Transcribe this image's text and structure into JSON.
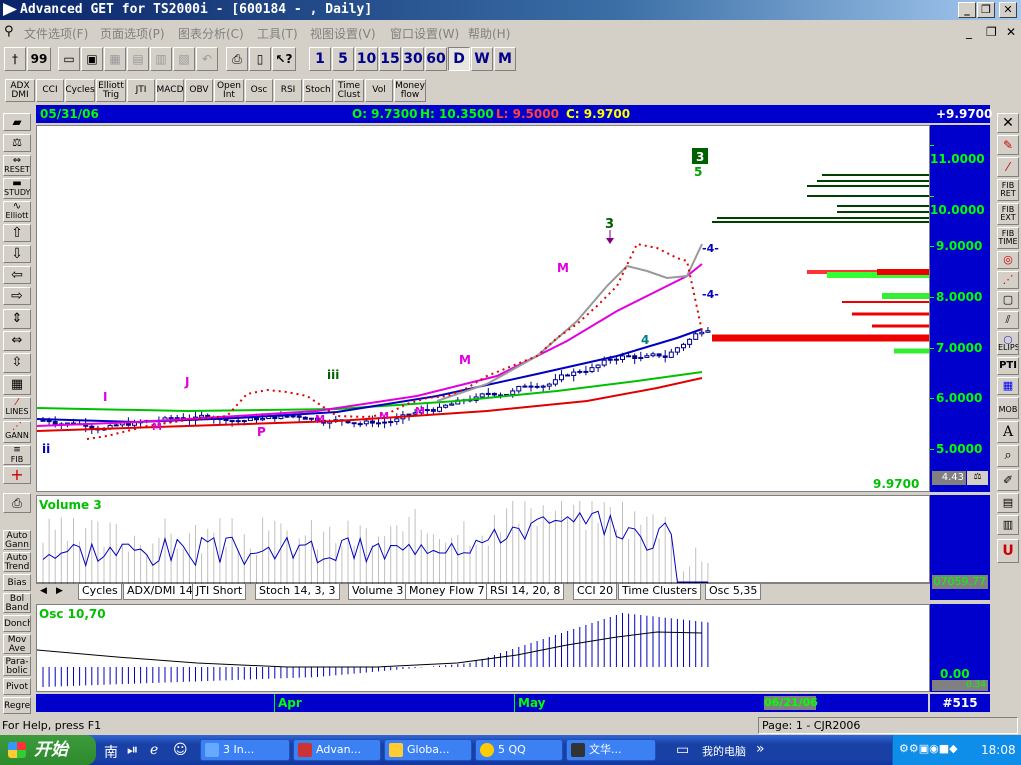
{
  "window": {
    "title": "Advanced GET for TS2000i - [600184 - , Daily]",
    "minimize": "_",
    "restore": "❐",
    "close": "✕"
  },
  "menu": {
    "items": [
      "文件选项(F)",
      "页面选项(P)",
      "图表分析(C)",
      "工具(T)",
      "视图设置(V)",
      "窗口设置(W)",
      "帮助(H)"
    ],
    "right_controls": [
      "_",
      "❐",
      "✕"
    ]
  },
  "toolbar": {
    "left_icons": [
      "†",
      "99"
    ],
    "periods": [
      "1",
      "5",
      "10",
      "15",
      "30",
      "60",
      "D",
      "W",
      "M"
    ],
    "active_period": "D"
  },
  "indicator_bar": {
    "buttons": [
      [
        "ADX",
        "DMI"
      ],
      [
        "CCI"
      ],
      [
        "Cycles"
      ],
      [
        "Elliott",
        "Trig"
      ],
      [
        "JTI"
      ],
      [
        "MACD"
      ],
      [
        "OBV"
      ],
      [
        "Open",
        "Int"
      ],
      [
        "Osc"
      ],
      [
        "RSI"
      ],
      [
        "Stoch"
      ],
      [
        "Time",
        "Clust"
      ],
      [
        "Vol"
      ],
      [
        "Money",
        "flow"
      ]
    ]
  },
  "info_bar": {
    "date": "05/31/06",
    "open": "O: 9.7300",
    "high": "H: 10.3500",
    "low": "L: 9.5000",
    "close": "C: 9.9700",
    "change": "+9.9700"
  },
  "main_chart": {
    "price_labels": [
      "11.0000",
      "10.0000",
      "9.0000",
      "8.0000",
      "7.0000",
      "6.0000",
      "5.0000"
    ],
    "last_price": "9.9700",
    "scale_readout": "4.43",
    "wave_labels": {
      "ii": "ii",
      "i": "I",
      "j": "J",
      "iii": "iii",
      "m_pink": "M",
      "m_high": "M",
      "three": "3",
      "four": "4",
      "five": "5",
      "box_three": "3",
      "p": "P"
    }
  },
  "volume_panel": {
    "title": "Volume 3",
    "readout": "07059.77"
  },
  "tabs": [
    "Cycles",
    "ADX/DMI 14",
    "JTI Short",
    "Stoch 14, 3, 3",
    "Volume 3",
    "Money Flow 7",
    "RSI 14, 20, 8",
    "CCI 20",
    "Time Clusters",
    "Osc 5,35"
  ],
  "osc_panel": {
    "title": "Osc 10,70",
    "readout": "0.00",
    "readout2": "0.34"
  },
  "time_axis": {
    "apr": "Apr",
    "may": "May",
    "date": "06/21/06",
    "page": "#515"
  },
  "left_toolbar": [
    "RESET",
    "STUDY",
    "Elliott",
    "LINES",
    "GANN",
    "FIB"
  ],
  "left_bottom": [
    [
      "Auto",
      "Gann"
    ],
    [
      "Auto",
      "Trend"
    ],
    [
      "Bias"
    ],
    [
      "Bol",
      "Band"
    ],
    [
      "Donch"
    ],
    [
      "Mov",
      "Ave"
    ],
    [
      "Para-",
      "bolic"
    ],
    [
      "Pivot"
    ],
    [
      "Regres"
    ]
  ],
  "right_toolbar": [
    "FIB RET",
    "FIB EXT",
    "FIB TIME",
    "ELIPS",
    "PTI",
    "MOB"
  ],
  "status": {
    "help": "For Help, press F1",
    "page": "Page: 1 - CJR2006"
  },
  "taskbar": {
    "start": "开始",
    "tasks": [
      "3 In...",
      "Advan...",
      "Globa...",
      "5 QQ",
      "文华...",
      "我的电脑"
    ],
    "clock": "18:08"
  },
  "colors": {
    "accent_blue": "#0000cc",
    "green_text": "#00ff00",
    "title_bar": "#0a246a"
  }
}
